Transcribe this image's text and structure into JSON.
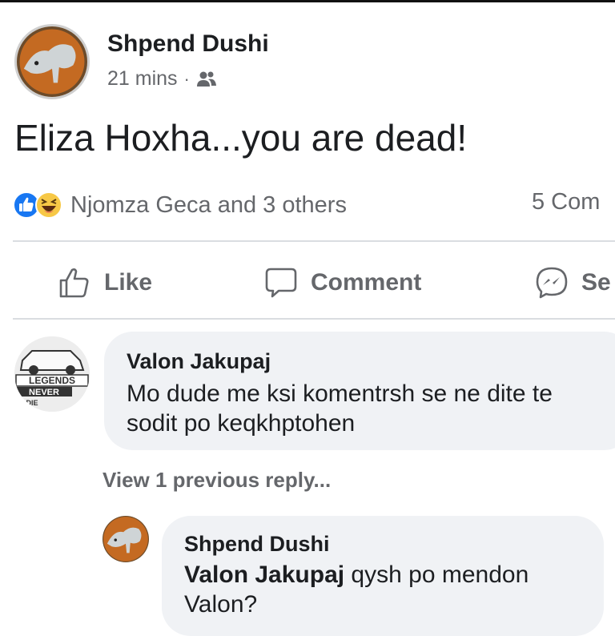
{
  "post": {
    "author": "Shpend Dushi",
    "time": "21 mins",
    "separator": "·",
    "privacy_icon": "friends-icon",
    "text": "Eliza Hoxha...you are dead!",
    "reactions": {
      "icons": [
        "like-icon",
        "haha-icon"
      ],
      "summary": "Njomza Geca and 3 others"
    },
    "comments_count": "5 Com"
  },
  "actions": {
    "like": "Like",
    "comment": "Comment",
    "send": "Se"
  },
  "comments": [
    {
      "author": "Valon Jakupaj",
      "lines": [
        "Mo dude me ksi komentrsh se ne dite te",
        "sodit po keqkhptohen"
      ],
      "avatar_text": [
        "LEGENDS",
        "NEVER",
        "DIE"
      ]
    }
  ],
  "view_previous": "View 1 previous reply...",
  "reply": {
    "author": "Shpend Dushi",
    "mention": "Valon Jakupaj",
    "text_after_mention": " qysh po mendon",
    "line2": "Valon?"
  },
  "colors": {
    "facebook_blue": "#1877f2",
    "bubble": "#f0f2f5",
    "secondary_text": "#65676b"
  }
}
